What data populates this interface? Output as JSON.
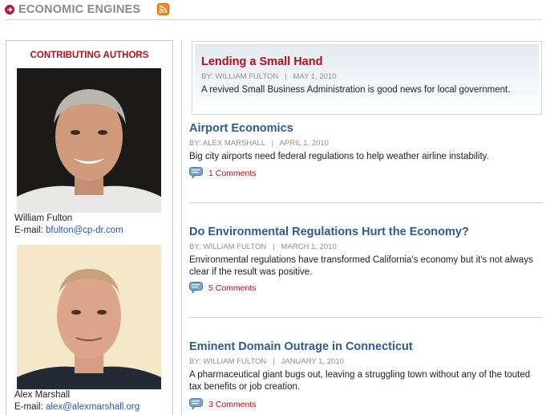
{
  "header": {
    "title": "ECONOMIC ENGINES"
  },
  "sidebar": {
    "heading": "CONTRIBUTING AUTHORS",
    "authors": [
      {
        "name": "William Fulton",
        "email_label": "E-mail:",
        "email": "bfulton@cp-dr.com"
      },
      {
        "name": "Alex Marshall",
        "email_label": "E-mail:",
        "email": "alex@alexmarshall.org"
      }
    ]
  },
  "featured": {
    "title": "Lending a Small Hand",
    "meta": "BY: WILLIAM FULTON   |   MAY 1, 2010",
    "summary": "A revived Small Business Administration is good news for local government."
  },
  "articles": [
    {
      "title": "Airport Economics",
      "meta": "BY: ALEX MARSHALL   |   APRIL 1, 2010",
      "summary": "Big city airports need federal regulations to help weather airline instability.",
      "comments": "1 Comments"
    },
    {
      "title": "Do Environmental Regulations Hurt the Economy?",
      "meta": "BY: WILLIAM FULTON   |   MARCH 1, 2010",
      "summary": "Environmental regulations have transformed California's economy but it's not always clear if the result was positive.",
      "comments": "5 Comments"
    },
    {
      "title": "Eminent Domain Outrage in Connecticut",
      "meta": "BY: WILLIAM FULTON   |   JANUARY 1, 2010",
      "summary": "A pharmaceutical giant bugs out, leaving a struggling town without any of the touted tax benefits or job creation.",
      "comments": "3 Comments"
    }
  ],
  "colors": {
    "accent_red": "#b2101c",
    "link_blue": "#2e5b92",
    "meta_gray": "#8e8e8e",
    "rss_orange": "#f08a24"
  },
  "icons": [
    "red-arrow-icon",
    "rss-feed-icon",
    "comment-bubble-icon"
  ]
}
